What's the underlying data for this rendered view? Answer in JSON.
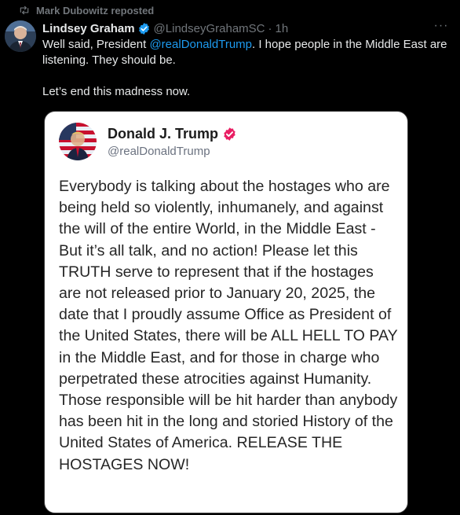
{
  "repost": {
    "label": "Mark Dubowitz reposted",
    "icon": "repost-icon"
  },
  "tweet": {
    "author_name": "Lindsey Graham",
    "verified_icon": "verified-badge-icon",
    "handle": "@LindseyGrahamSC",
    "separator": "·",
    "time": "1h",
    "more_icon": "more-options-icon",
    "text_before_mention": "Well said, President ",
    "mention": "@realDonaldTrump",
    "text_after_mention": ". I hope people in the Middle East are listening. They should be.",
    "text_line2": "Let’s end this madness now."
  },
  "card": {
    "author_name": "Donald J. Trump",
    "verified_icon": "verified-badge-icon",
    "handle": "@realDonaldTrump",
    "body": "Everybody is talking about the hostages who are being held so violently, inhumanely, and against the will of the entire World, in the Middle East - But it’s all talk, and no action! Please let this TRUTH serve to represent that if the hostages are not released prior to January 20, 2025, the date that I proudly assume Office as President of the United States, there will be ALL HELL TO PAY in the Middle East, and for those in charge who perpetrated these atrocities against Humanity. Those responsible will be hit harder than anybody has been hit in the long and storied History of the United States of America. RELEASE THE HOSTAGES NOW!"
  },
  "colors": {
    "background": "#000000",
    "text_primary": "#e7e9ea",
    "text_secondary": "#71767b",
    "link": "#1d9bf0",
    "verified_blue": "#1d9bf0",
    "verified_card": "#e91e63",
    "card_background": "#ffffff"
  }
}
